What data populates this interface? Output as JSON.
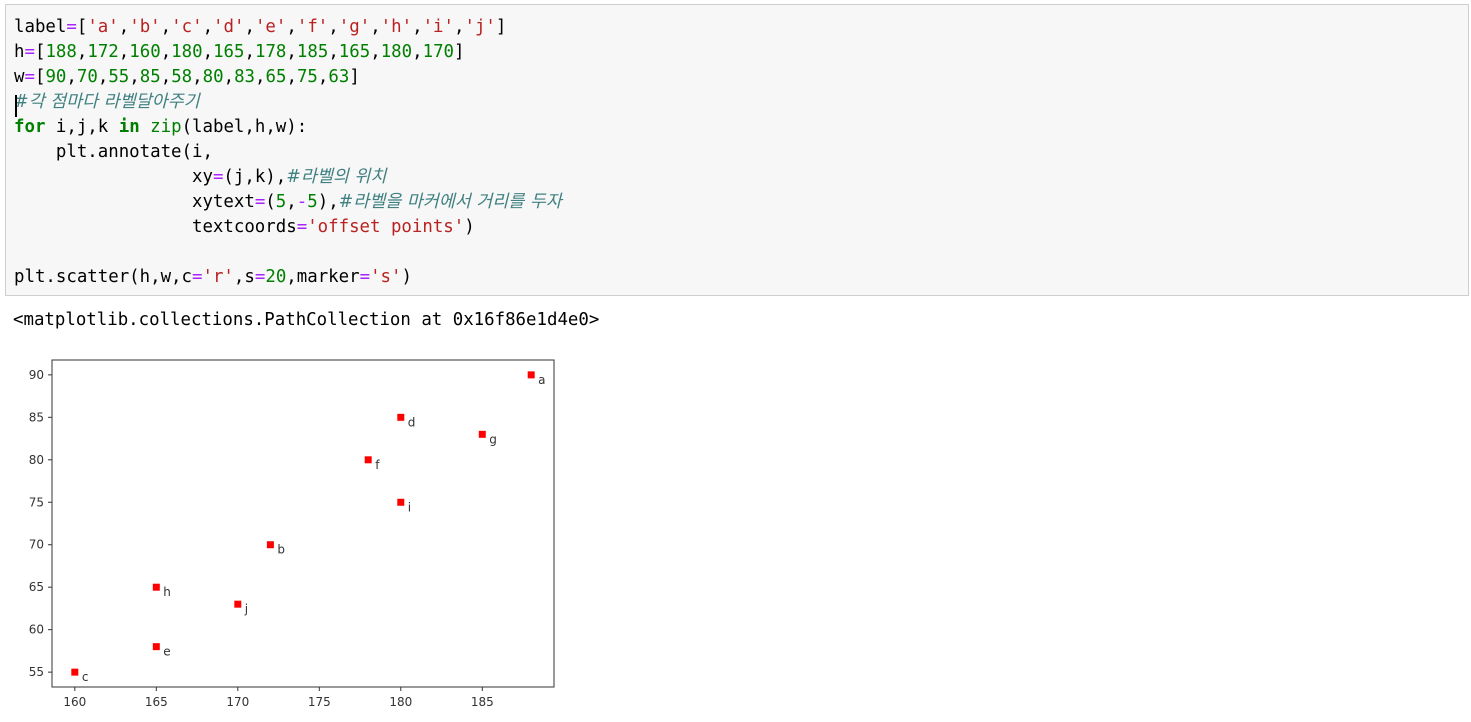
{
  "code_cell": {
    "lines": [
      [
        {
          "t": "label",
          "c": ""
        },
        {
          "t": "=",
          "c": "op"
        },
        {
          "t": "[",
          "c": ""
        },
        {
          "t": "'a'",
          "c": "str"
        },
        {
          "t": ",",
          "c": ""
        },
        {
          "t": "'b'",
          "c": "str"
        },
        {
          "t": ",",
          "c": ""
        },
        {
          "t": "'c'",
          "c": "str"
        },
        {
          "t": ",",
          "c": ""
        },
        {
          "t": "'d'",
          "c": "str"
        },
        {
          "t": ",",
          "c": ""
        },
        {
          "t": "'e'",
          "c": "str"
        },
        {
          "t": ",",
          "c": ""
        },
        {
          "t": "'f'",
          "c": "str"
        },
        {
          "t": ",",
          "c": ""
        },
        {
          "t": "'g'",
          "c": "str"
        },
        {
          "t": ",",
          "c": ""
        },
        {
          "t": "'h'",
          "c": "str"
        },
        {
          "t": ",",
          "c": ""
        },
        {
          "t": "'i'",
          "c": "str"
        },
        {
          "t": ",",
          "c": ""
        },
        {
          "t": "'j'",
          "c": "str"
        },
        {
          "t": "]",
          "c": ""
        }
      ],
      [
        {
          "t": "h",
          "c": ""
        },
        {
          "t": "=",
          "c": "op"
        },
        {
          "t": "[",
          "c": ""
        },
        {
          "t": "188",
          "c": "num"
        },
        {
          "t": ",",
          "c": ""
        },
        {
          "t": "172",
          "c": "num"
        },
        {
          "t": ",",
          "c": ""
        },
        {
          "t": "160",
          "c": "num"
        },
        {
          "t": ",",
          "c": ""
        },
        {
          "t": "180",
          "c": "num"
        },
        {
          "t": ",",
          "c": ""
        },
        {
          "t": "165",
          "c": "num"
        },
        {
          "t": ",",
          "c": ""
        },
        {
          "t": "178",
          "c": "num"
        },
        {
          "t": ",",
          "c": ""
        },
        {
          "t": "185",
          "c": "num"
        },
        {
          "t": ",",
          "c": ""
        },
        {
          "t": "165",
          "c": "num"
        },
        {
          "t": ",",
          "c": ""
        },
        {
          "t": "180",
          "c": "num"
        },
        {
          "t": ",",
          "c": ""
        },
        {
          "t": "170",
          "c": "num"
        },
        {
          "t": "]",
          "c": ""
        }
      ],
      [
        {
          "t": "w",
          "c": ""
        },
        {
          "t": "=",
          "c": "op"
        },
        {
          "t": "[",
          "c": ""
        },
        {
          "t": "90",
          "c": "num"
        },
        {
          "t": ",",
          "c": ""
        },
        {
          "t": "70",
          "c": "num"
        },
        {
          "t": ",",
          "c": ""
        },
        {
          "t": "55",
          "c": "num"
        },
        {
          "t": ",",
          "c": ""
        },
        {
          "t": "85",
          "c": "num"
        },
        {
          "t": ",",
          "c": ""
        },
        {
          "t": "58",
          "c": "num"
        },
        {
          "t": ",",
          "c": ""
        },
        {
          "t": "80",
          "c": "num"
        },
        {
          "t": ",",
          "c": ""
        },
        {
          "t": "83",
          "c": "num"
        },
        {
          "t": ",",
          "c": ""
        },
        {
          "t": "65",
          "c": "num"
        },
        {
          "t": ",",
          "c": ""
        },
        {
          "t": "75",
          "c": "num"
        },
        {
          "t": ",",
          "c": ""
        },
        {
          "t": "63",
          "c": "num"
        },
        {
          "t": "]",
          "c": ""
        }
      ],
      [
        {
          "t": "#각 점마다 라벨달아주기",
          "c": "cm"
        }
      ],
      [
        {
          "t": "for",
          "c": "kw"
        },
        {
          "t": " i,j,k ",
          "c": ""
        },
        {
          "t": "in",
          "c": "kw"
        },
        {
          "t": " ",
          "c": ""
        },
        {
          "t": "zip",
          "c": "bi"
        },
        {
          "t": "(label,h,w):",
          "c": ""
        }
      ],
      [
        {
          "t": "    plt.annotate(i,",
          "c": ""
        }
      ],
      [
        {
          "t": "                 xy",
          "c": ""
        },
        {
          "t": "=",
          "c": "op"
        },
        {
          "t": "(j,k),",
          "c": ""
        },
        {
          "t": "#라벨의 위치",
          "c": "cm"
        }
      ],
      [
        {
          "t": "                 xytext",
          "c": ""
        },
        {
          "t": "=",
          "c": "op"
        },
        {
          "t": "(",
          "c": ""
        },
        {
          "t": "5",
          "c": "num"
        },
        {
          "t": ",",
          "c": ""
        },
        {
          "t": "-",
          "c": "op"
        },
        {
          "t": "5",
          "c": "num"
        },
        {
          "t": "),",
          "c": ""
        },
        {
          "t": "#라벨을 마커에서 거리를 두자",
          "c": "cm"
        }
      ],
      [
        {
          "t": "                 textcoords",
          "c": ""
        },
        {
          "t": "=",
          "c": "op"
        },
        {
          "t": "'offset points'",
          "c": "str"
        },
        {
          "t": ")",
          "c": ""
        }
      ],
      [],
      [
        {
          "t": "plt.scatter(h,w,c",
          "c": ""
        },
        {
          "t": "=",
          "c": "op"
        },
        {
          "t": "'r'",
          "c": "str"
        },
        {
          "t": ",s",
          "c": ""
        },
        {
          "t": "=",
          "c": "op"
        },
        {
          "t": "20",
          "c": "num"
        },
        {
          "t": ",marker",
          "c": ""
        },
        {
          "t": "=",
          "c": "op"
        },
        {
          "t": "'s'",
          "c": "str"
        },
        {
          "t": ")",
          "c": ""
        }
      ]
    ]
  },
  "output": {
    "text": "<matplotlib.collections.PathCollection at 0x16f86e1d4e0>"
  },
  "chart_data": {
    "type": "scatter",
    "marker_color": "#ff0000",
    "marker": "square",
    "points": [
      {
        "label": "a",
        "x": 188,
        "y": 90
      },
      {
        "label": "b",
        "x": 172,
        "y": 70
      },
      {
        "label": "c",
        "x": 160,
        "y": 55
      },
      {
        "label": "d",
        "x": 180,
        "y": 85
      },
      {
        "label": "e",
        "x": 165,
        "y": 58
      },
      {
        "label": "f",
        "x": 178,
        "y": 80
      },
      {
        "label": "g",
        "x": 185,
        "y": 83
      },
      {
        "label": "h",
        "x": 165,
        "y": 65
      },
      {
        "label": "i",
        "x": 180,
        "y": 75
      },
      {
        "label": "j",
        "x": 170,
        "y": 63
      }
    ],
    "xticks": [
      160,
      165,
      170,
      175,
      180,
      185
    ],
    "yticks": [
      55,
      60,
      65,
      70,
      75,
      80,
      85,
      90
    ],
    "xlim": [
      158.6,
      189.4
    ],
    "ylim": [
      53.25,
      91.75
    ],
    "grid": false,
    "title": "",
    "xlabel": "",
    "ylabel": ""
  }
}
